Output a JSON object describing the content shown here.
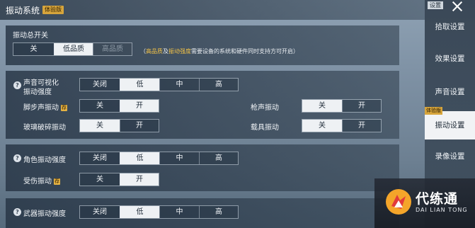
{
  "header": {
    "title": "振动系统",
    "beta_tag": "体验版",
    "settings_tab": "设置"
  },
  "master": {
    "label": "振动总开关",
    "options": [
      "关",
      "低品质",
      "高品质"
    ],
    "selected": 1,
    "note_parts": [
      "（",
      "高品质",
      "及",
      "振动强度",
      "需要设备的系统和硬件同时支持方可开启）"
    ]
  },
  "sound_vis": {
    "label_line1": "声音可视化",
    "label_line2": "振动强度",
    "options": [
      "关闭",
      "低",
      "中",
      "高"
    ],
    "selected": 1
  },
  "footstep": {
    "label": "脚步声振动",
    "tag": "荐",
    "options": [
      "关",
      "开"
    ],
    "selected": 1
  },
  "gunshot": {
    "label": "枪声振动",
    "options": [
      "关",
      "开"
    ],
    "selected": 0
  },
  "glass": {
    "label": "玻璃破碎振动",
    "options": [
      "关",
      "开"
    ],
    "selected": 0
  },
  "vehicle": {
    "label": "载具振动",
    "options": [
      "关",
      "开"
    ],
    "selected": 0
  },
  "character": {
    "label": "角色振动强度",
    "options": [
      "关闭",
      "低",
      "中",
      "高"
    ],
    "selected": 1
  },
  "hurt": {
    "label": "受伤振动",
    "tag": "荐",
    "options": [
      "关",
      "开"
    ],
    "selected": 1
  },
  "weapon": {
    "label": "武器振动强度",
    "options": [
      "关闭",
      "低",
      "中",
      "高"
    ],
    "selected": 1
  },
  "sidebar": {
    "items": [
      {
        "label": "拾取设置"
      },
      {
        "label": "效果设置"
      },
      {
        "label": "声音设置"
      },
      {
        "label": "振动设置",
        "beta": "体验版"
      },
      {
        "label": "录像设置"
      }
    ],
    "active": 3
  },
  "logo": {
    "name_cn": "代练通",
    "name_en": "DAI LIAN TONG"
  },
  "colors": {
    "selected_bg": "#eef1f4",
    "accent_yellow": "#f2c247",
    "tag_gold": "#d7a53c"
  }
}
